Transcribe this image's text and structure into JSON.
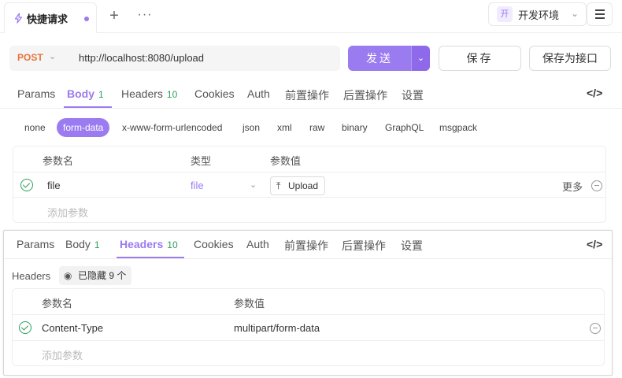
{
  "tabbar": {
    "tab_title": "快捷请求",
    "new_tab_symbol": "+",
    "more_symbol": "···",
    "env_badge": "开",
    "env_label": "开发环境"
  },
  "request": {
    "method": "POST",
    "url": "http://localhost:8080/upload",
    "send_label": "发送",
    "save_label": "保存",
    "save_as_api_label": "保存为接口"
  },
  "request_tabs": {
    "items": [
      {
        "label": "Params"
      },
      {
        "label": "Body",
        "count": "1"
      },
      {
        "label": "Headers",
        "count": "10"
      },
      {
        "label": "Cookies"
      },
      {
        "label": "Auth"
      },
      {
        "label": "前置操作"
      },
      {
        "label": "后置操作"
      },
      {
        "label": "设置"
      }
    ],
    "active": "Body"
  },
  "body_types": [
    "none",
    "form-data",
    "x-www-form-urlencoded",
    "json",
    "xml",
    "raw",
    "binary",
    "GraphQL",
    "msgpack"
  ],
  "body_type_selected": "form-data",
  "form_table": {
    "headers": [
      "参数名",
      "类型",
      "参数值"
    ],
    "rows": [
      {
        "name": "file",
        "type": "file",
        "value_button": "Upload",
        "more": "更多"
      }
    ],
    "add_placeholder": "添加参数"
  },
  "headers_panel": {
    "tabs": [
      {
        "label": "Params"
      },
      {
        "label": "Body",
        "count": "1"
      },
      {
        "label": "Headers",
        "count": "10"
      },
      {
        "label": "Cookies"
      },
      {
        "label": "Auth"
      },
      {
        "label": "前置操作"
      },
      {
        "label": "后置操作"
      },
      {
        "label": "设置"
      }
    ],
    "active": "Headers",
    "section_label": "Headers",
    "hidden_chip": "已隐藏 9 个",
    "table": {
      "headers": [
        "参数名",
        "参数值"
      ],
      "rows": [
        {
          "name": "Content-Type",
          "value": "multipart/form-data"
        }
      ],
      "add_placeholder": "添加参数"
    }
  },
  "colors": {
    "accent": "#9b7bf0",
    "method_post": "#e8743b",
    "count_green": "#2aa05a"
  }
}
